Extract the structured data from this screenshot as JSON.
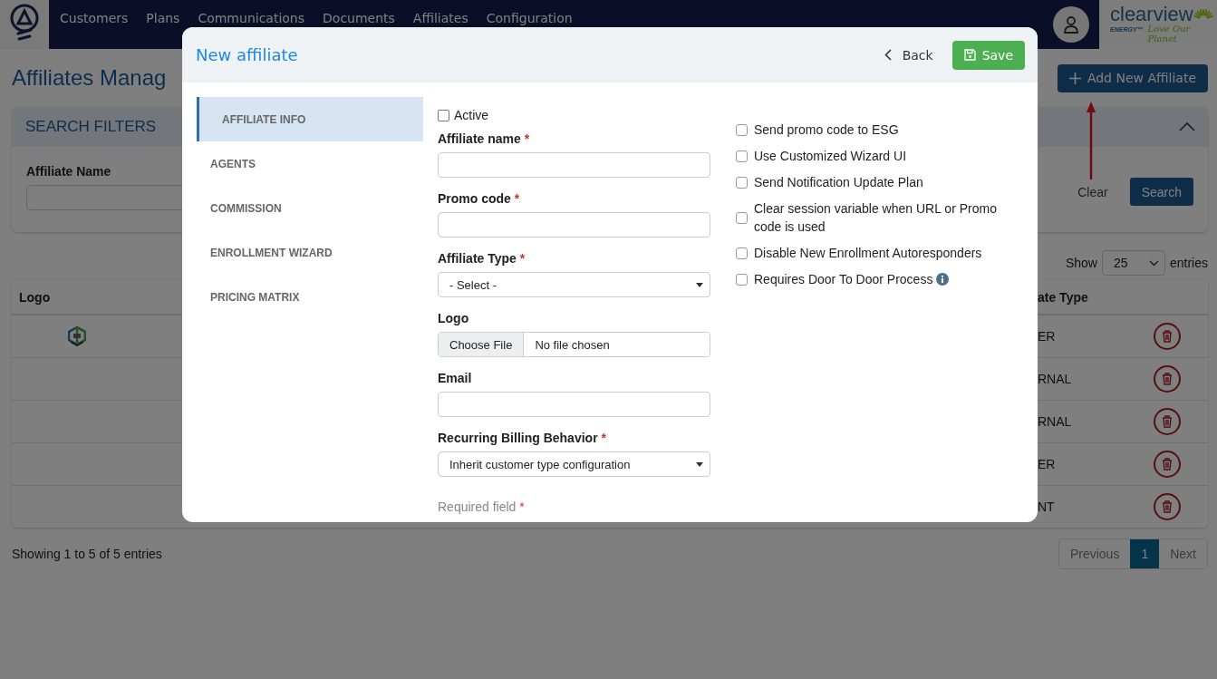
{
  "nav": {
    "items": [
      "Customers",
      "Plans",
      "Communications",
      "Documents",
      "Affiliates",
      "Configuration"
    ]
  },
  "brand": {
    "name": "clearview",
    "sub": "ENERGY™",
    "tagline": "Love Our Planet"
  },
  "page": {
    "title": "Affiliates Manag",
    "add_button": "Add New Affiliate"
  },
  "search_filters": {
    "title": "SEARCH FILTERS",
    "expanded": true,
    "field_label": "Affiliate Name",
    "clear": "Clear",
    "search": "Search"
  },
  "entries": {
    "show": "Show",
    "value": "25",
    "suffix": "entries"
  },
  "table": {
    "columns": [
      "Logo",
      "ate Type"
    ],
    "rows": [
      {
        "has_logo": true,
        "type": "ER"
      },
      {
        "has_logo": false,
        "type": "RNAL"
      },
      {
        "has_logo": false,
        "type": "RNAL"
      },
      {
        "has_logo": false,
        "type": "ER"
      },
      {
        "has_logo": false,
        "type": "NT"
      }
    ]
  },
  "footer": {
    "summary": "Showing 1 to 5 of 5 entries",
    "pages": [
      {
        "label": "Previous",
        "selected": false
      },
      {
        "label": "1",
        "selected": true
      },
      {
        "label": "Next",
        "selected": false
      }
    ]
  },
  "annotation_arrow": true,
  "modal": {
    "title": "New affiliate",
    "back": "Back",
    "save": "Save",
    "tabs": [
      {
        "label": "AFFILIATE INFO",
        "selected": true
      },
      {
        "label": "AGENTS",
        "selected": false
      },
      {
        "label": "COMMISSION",
        "selected": false
      },
      {
        "label": "ENROLLMENT WIZARD",
        "selected": false
      },
      {
        "label": "PRICING MATRIX",
        "selected": false
      }
    ],
    "active": {
      "label": "Active",
      "checked": false
    },
    "fields": [
      {
        "kind": "text",
        "label": "Affiliate name",
        "required_mark": "*"
      },
      {
        "kind": "text",
        "label": "Promo code",
        "required_mark": "*"
      },
      {
        "kind": "select",
        "label": "Affiliate Type",
        "required_mark": "*",
        "value": "- Select -"
      },
      {
        "kind": "file",
        "label": "Logo",
        "button": "Choose File",
        "value": "No file chosen"
      },
      {
        "kind": "text",
        "label": "Email"
      },
      {
        "kind": "select",
        "label": "Recurring Billing Behavior",
        "required_mark": "*",
        "value": "Inherit customer type configuration"
      }
    ],
    "note": {
      "text": "Required field",
      "required_mark": "*"
    },
    "options": [
      {
        "label": "Send promo code to ESG",
        "checked": false,
        "info": false
      },
      {
        "label": "Use Customized Wizard UI",
        "checked": false,
        "info": false
      },
      {
        "label": "Send Notification Update Plan",
        "checked": false,
        "info": false
      },
      {
        "label": "Clear session variable when URL or Promo code is used",
        "checked": false,
        "info": false
      },
      {
        "label": "Disable New Enrollment Autoresponders",
        "checked": false,
        "info": false
      },
      {
        "label": "Requires Door To Door Process",
        "checked": false,
        "info": true
      }
    ]
  }
}
